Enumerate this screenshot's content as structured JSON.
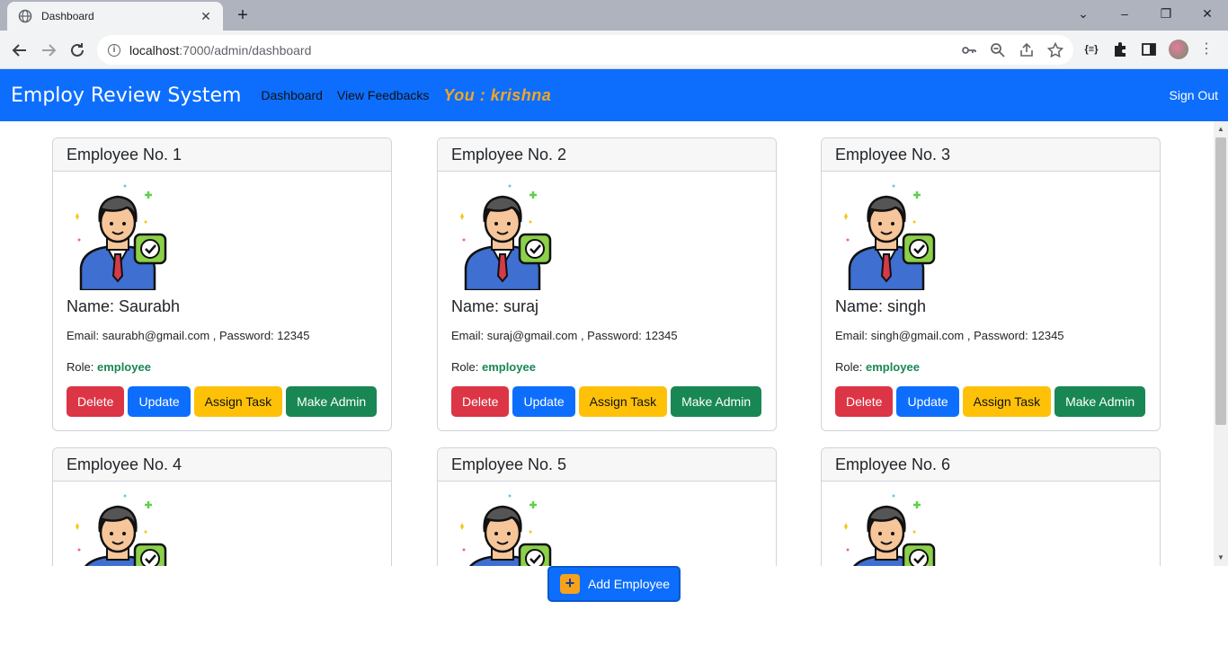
{
  "browser": {
    "tab_title": "Dashboard",
    "url_host": "localhost",
    "url_rest": ":7000/admin/dashboard"
  },
  "nav": {
    "brand": "Employ Review System",
    "links": [
      "Dashboard",
      "View Feedbacks"
    ],
    "you_label": "You : krishna",
    "signout": "Sign Out"
  },
  "employees": [
    {
      "header": "Employee No. 1",
      "name": "Name: Saurabh",
      "info": "Email: saurabh@gmail.com , Password: 12345",
      "role_label": "Role: ",
      "role": "employee"
    },
    {
      "header": "Employee No. 2",
      "name": "Name: suraj",
      "info": "Email: suraj@gmail.com , Password: 12345",
      "role_label": "Role: ",
      "role": "employee"
    },
    {
      "header": "Employee No. 3",
      "name": "Name: singh",
      "info": "Email: singh@gmail.com , Password: 12345",
      "role_label": "Role: ",
      "role": "employee"
    },
    {
      "header": "Employee No. 4"
    },
    {
      "header": "Employee No. 5"
    },
    {
      "header": "Employee No. 6"
    }
  ],
  "buttons": {
    "delete": "Delete",
    "update": "Update",
    "assign": "Assign Task",
    "admin": "Make Admin"
  },
  "add_employee": {
    "label": "Add Employee",
    "icon": "+"
  },
  "colors": {
    "primary": "#0d6efd",
    "danger": "#dc3545",
    "warning": "#ffc107",
    "success": "#198754",
    "you_accent": "#f5a623"
  }
}
